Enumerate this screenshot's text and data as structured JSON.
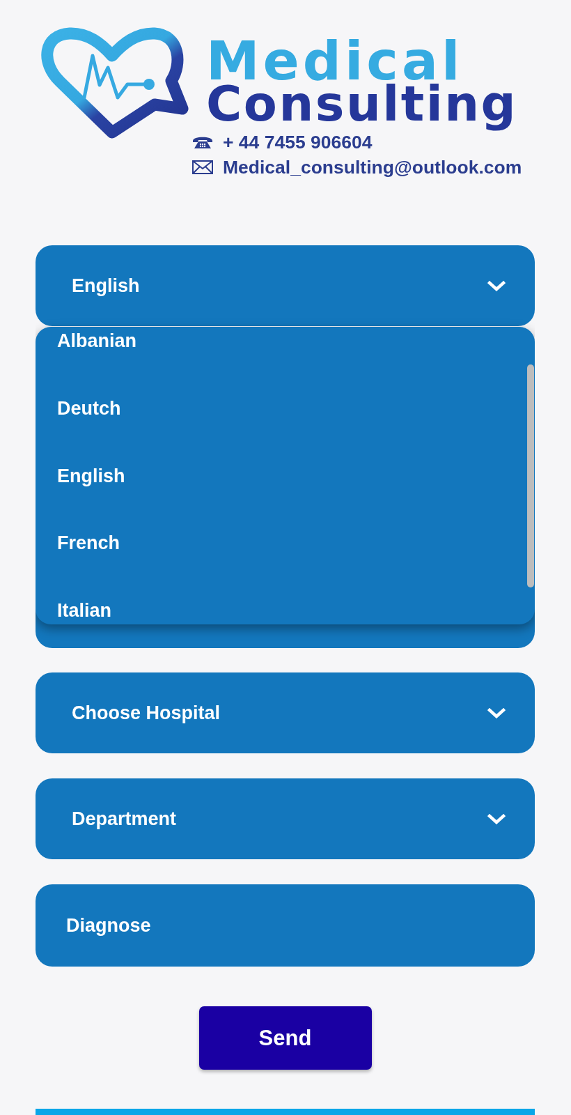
{
  "logo": {
    "title_line_1": "Medical",
    "title_line_2": "Consulting",
    "phone": "+ 44 7455 906604",
    "email": "Medical_consulting@outlook.com"
  },
  "language_select": {
    "value": "English",
    "expanded": true,
    "options": [
      {
        "label": "Albanian"
      },
      {
        "label": "Deutch"
      },
      {
        "label": "English"
      },
      {
        "label": "French"
      },
      {
        "label": "Italian"
      }
    ]
  },
  "fields": [
    {
      "kind": "select",
      "value": "Choose Hospital"
    },
    {
      "kind": "select",
      "value": "Department"
    },
    {
      "kind": "input",
      "placeholder": "Diagnose"
    }
  ],
  "send_button": {
    "label": "Send"
  }
}
